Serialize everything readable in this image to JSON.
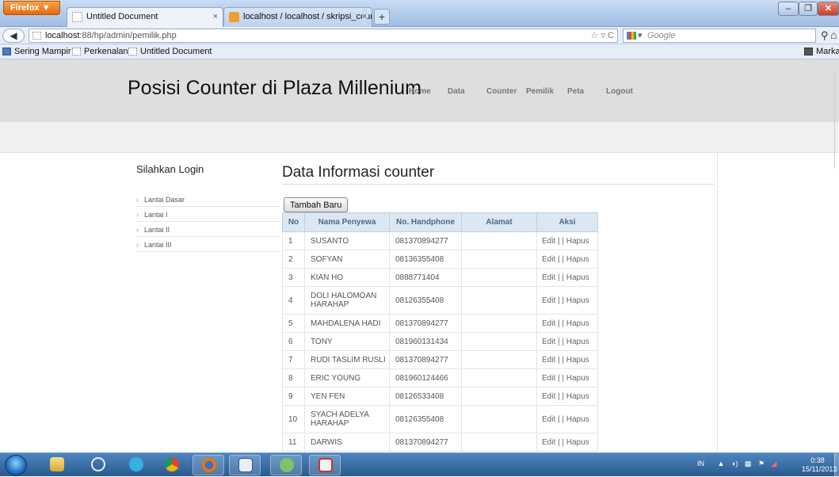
{
  "browser": {
    "firefox_button": "Firefox ▼",
    "tabs": [
      {
        "label": "Untitled Document"
      },
      {
        "label": "localhost / localhost / skripsi_counter..."
      }
    ],
    "url_host": "localhost",
    "url_rest": ":88/hp/admin/pemilik.php",
    "search_placeholder": "Google",
    "bookmarks": [
      "Sering Mampir",
      "Perkenalan",
      "Untitled Document"
    ],
    "bookmarks_right": "Marka"
  },
  "site": {
    "title": "Posisi Counter di Plaza Millenium",
    "nav": [
      "Home",
      "Data",
      "Counter",
      "Pemilik",
      "Peta",
      "Logout"
    ]
  },
  "sidebar": {
    "title": "Silahkan Login",
    "items": [
      "Lantai Dasar",
      "Lantai I",
      "Lantai II",
      "Lantai III"
    ]
  },
  "content": {
    "title": "Data Informasi counter",
    "add_button": "Tambah Baru",
    "columns": [
      "No",
      "Nama Penyewa",
      "No. Handphone",
      "Alamat",
      "Aksi"
    ],
    "rows": [
      {
        "no": "1",
        "nama": "SUSANTO",
        "hp": "081370894277",
        "alamat": "",
        "aksi": "Edit | | Hapus"
      },
      {
        "no": "2",
        "nama": "SOFYAN",
        "hp": "08136355408",
        "alamat": "",
        "aksi": "Edit | | Hapus"
      },
      {
        "no": "3",
        "nama": "KIAN HO",
        "hp": "0888771404",
        "alamat": "",
        "aksi": "Edit | | Hapus"
      },
      {
        "no": "4",
        "nama": "DOLI HALOMOAN HARAHAP",
        "hp": "08126355408",
        "alamat": "",
        "aksi": "Edit | | Hapus"
      },
      {
        "no": "5",
        "nama": "MAHDALENA HADI",
        "hp": "081370894277",
        "alamat": "",
        "aksi": "Edit | | Hapus"
      },
      {
        "no": "6",
        "nama": "TONY",
        "hp": "081960131434",
        "alamat": "",
        "aksi": "Edit | | Hapus"
      },
      {
        "no": "7",
        "nama": "RUDI TASLIM RUSLI",
        "hp": "081370894277",
        "alamat": "",
        "aksi": "Edit | | Hapus"
      },
      {
        "no": "8",
        "nama": "ERIC YOUNG",
        "hp": "081960124466",
        "alamat": "",
        "aksi": "Edit | | Hapus"
      },
      {
        "no": "9",
        "nama": "YEN FEN",
        "hp": "08126533408",
        "alamat": "",
        "aksi": "Edit | | Hapus"
      },
      {
        "no": "10",
        "nama": "SYACH ADELYA HARAHAP",
        "hp": "08126355408",
        "alamat": "",
        "aksi": "Edit | | Hapus"
      },
      {
        "no": "11",
        "nama": "DARWIS",
        "hp": "081370894277",
        "alamat": "",
        "aksi": "Edit | | Hapus"
      }
    ]
  },
  "taskbar": {
    "tray_lang": "IN",
    "clock_time": "0:38",
    "clock_date": "15/11/2013"
  },
  "colors": {
    "header_bg": "#dedede",
    "table_header_bg": "#dbe7f1",
    "taskbar": "#3a6ea5"
  }
}
